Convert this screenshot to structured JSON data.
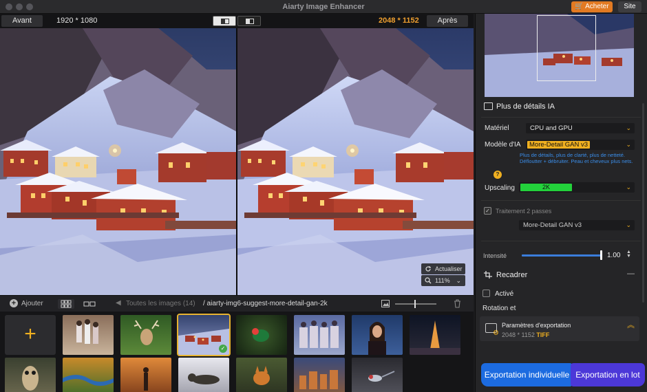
{
  "window": {
    "title": "Aiarty Image Enhancer"
  },
  "titlebar": {
    "buy_label": "Acheter",
    "site_label": "Site"
  },
  "compare": {
    "before_label": "Avant",
    "before_res": "1920 * 1080",
    "after_res": "2048 * 1152",
    "after_label": "Après",
    "refresh_label": "Actualiser",
    "zoom_value": "111%"
  },
  "filebar": {
    "add_label": "Ajouter",
    "all_images": "Toutes les images (14)",
    "current_path": "/ aiarty-img6-suggest-more-detail-gan-2k"
  },
  "thumbnails": [
    {
      "name": "thumb-kids",
      "selected": false
    },
    {
      "name": "thumb-deer",
      "selected": false
    },
    {
      "name": "thumb-village",
      "selected": true
    },
    {
      "name": "thumb-bird",
      "selected": false
    },
    {
      "name": "thumb-women",
      "selected": false
    },
    {
      "name": "thumb-portrait",
      "selected": false
    },
    {
      "name": "thumb-tower",
      "selected": false
    },
    {
      "name": "thumb-owl",
      "selected": false
    },
    {
      "name": "thumb-river",
      "selected": false
    },
    {
      "name": "thumb-autumn",
      "selected": false
    },
    {
      "name": "thumb-otter",
      "selected": false
    },
    {
      "name": "thumb-fox",
      "selected": false
    },
    {
      "name": "thumb-city",
      "selected": false
    },
    {
      "name": "thumb-hummingbird",
      "selected": false
    }
  ],
  "panel": {
    "section_detail": "Plus de détails IA",
    "material_label": "Matériel",
    "material_value": "CPU and GPU",
    "model_label": "Modèle d'IA",
    "model_value": "More-Detail GAN  v3",
    "model_desc": "Plus de détails, plus de clarté, plus de netteté. Défloutter + débruiter. Peau et cheveux plus nets.",
    "upscaling_label": "Upscaling",
    "upscaling_value": "2K",
    "two_pass_label": "Traitement 2 passes",
    "two_pass_model": "More-Detail GAN  v3",
    "intensity_label": "Intensité",
    "intensity_value": "1.00",
    "intensity_level": 1.0,
    "crop_label": "Recadrer",
    "crop_collapse": "—",
    "active_label": "Activé",
    "rotation_label": "Rotation et",
    "export_params_title": "Paramètres d'exportation",
    "export_params_res": "2048 * 1152",
    "export_params_format": "TIFF",
    "export_single": "Exportation individuelle",
    "export_batch": "Exportation en lot"
  },
  "colors": {
    "accent": "#f0b020",
    "buy": "#e27a22",
    "upscale_bar": "#23d23b",
    "link_blue": "#3b8eea",
    "export_single": "#1c6be0",
    "export_batch": "#4c38d8"
  }
}
